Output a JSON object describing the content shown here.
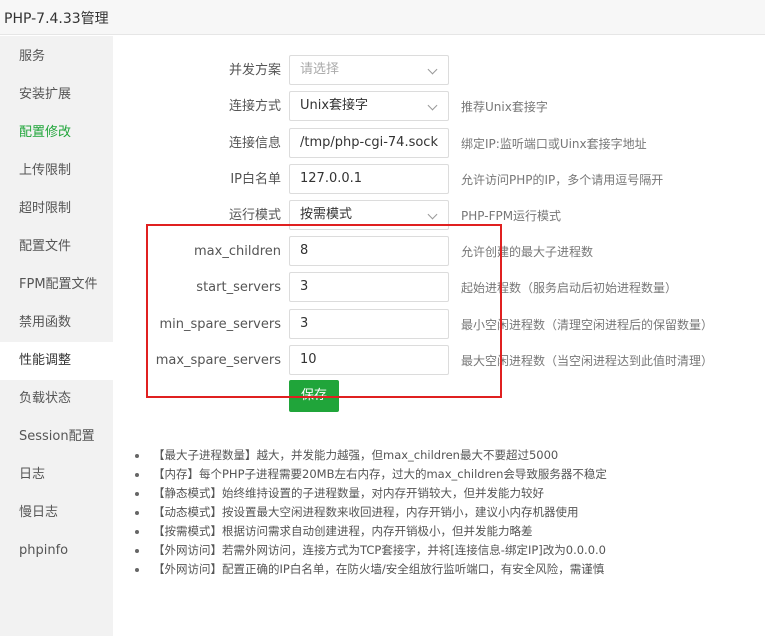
{
  "window": {
    "title": "PHP-7.4.33管理"
  },
  "sidebar": {
    "items": [
      {
        "label": "服务"
      },
      {
        "label": "安装扩展"
      },
      {
        "label": "配置修改"
      },
      {
        "label": "上传限制"
      },
      {
        "label": "超时限制"
      },
      {
        "label": "配置文件"
      },
      {
        "label": "FPM配置文件"
      },
      {
        "label": "禁用函数"
      },
      {
        "label": "性能调整"
      },
      {
        "label": "负载状态"
      },
      {
        "label": "Session配置"
      },
      {
        "label": "日志"
      },
      {
        "label": "慢日志"
      },
      {
        "label": "phpinfo"
      }
    ],
    "active_item": "性能调整",
    "highlight_color": "#20a53a"
  },
  "form": {
    "concurrency": {
      "label": "并发方案",
      "placeholder": "请选择",
      "hint": ""
    },
    "connection_mode": {
      "label": "连接方式",
      "value": "Unix套接字",
      "hint": "推荐Unix套接字"
    },
    "connection_info": {
      "label": "连接信息",
      "value": "/tmp/php-cgi-74.sock",
      "hint": "绑定IP:监听端口或Uinx套接字地址"
    },
    "ip_whitelist": {
      "label": "IP白名单",
      "value": "127.0.0.1",
      "hint": "允许访问PHP的IP，多个请用逗号隔开"
    },
    "run_mode": {
      "label": "运行模式",
      "value": "按需模式",
      "hint": "PHP-FPM运行模式"
    },
    "max_children": {
      "label": "max_children",
      "value": "8",
      "hint": "允许创建的最大子进程数"
    },
    "start_servers": {
      "label": "start_servers",
      "value": "3",
      "hint": "起始进程数（服务启动后初始进程数量）"
    },
    "min_spare_servers": {
      "label": "min_spare_servers",
      "value": "3",
      "hint": "最小空闲进程数（清理空闲进程后的保留数量）"
    },
    "max_spare_servers": {
      "label": "max_spare_servers",
      "value": "10",
      "hint": "最大空闲进程数（当空闲进程达到此值时清理）"
    },
    "save_label": "保存"
  },
  "notes": [
    "【最大子进程数量】越大，并发能力越强，但max_children最大不要超过5000",
    "【内存】每个PHP子进程需要20MB左右内存，过大的max_children会导致服务器不稳定",
    "【静态模式】始终维持设置的子进程数量，对内存开销较大，但并发能力较好",
    "【动态模式】按设置最大空闲进程数来收回进程，内存开销小，建议小内存机器使用",
    "【按需模式】根据访问需求自动创建进程，内存开销极小，但并发能力略差",
    "【外网访问】若需外网访问，连接方式为TCP套接字，并将[连接信息-绑定IP]改为0.0.0.0",
    "【外网访问】配置正确的IP白名单，在防火墙/安全组放行监听端口，有安全风险，需谨慎"
  ],
  "colors": {
    "accent": "#20a53a",
    "highlight_box": "#e02020"
  }
}
